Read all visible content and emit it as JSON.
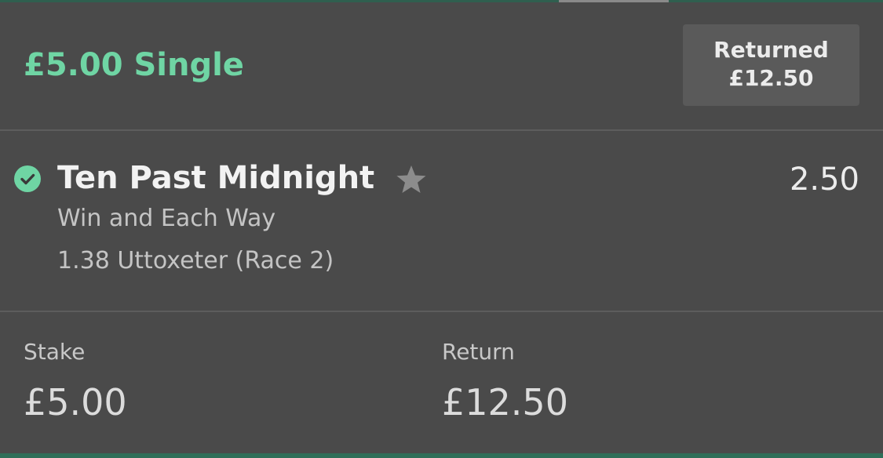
{
  "header": {
    "bet_title": "£5.00 Single",
    "returned_label": "Returned",
    "returned_amount": "£12.50"
  },
  "selection": {
    "name": "Ten Past Midnight",
    "odds": "2.50",
    "market": "Win and Each Way",
    "event": "1.38 Uttoxeter (Race 2)",
    "status_icon": "check-circle-icon",
    "favourite_icon": "star-icon"
  },
  "footer": {
    "stake_label": "Stake",
    "stake_value": "£5.00",
    "return_label": "Return",
    "return_value": "£12.50"
  },
  "colors": {
    "background": "#4a4a4a",
    "accent_green": "#6fd5a4",
    "returned_box": "#5a5a5a",
    "star_grey": "#8c8c8c"
  }
}
